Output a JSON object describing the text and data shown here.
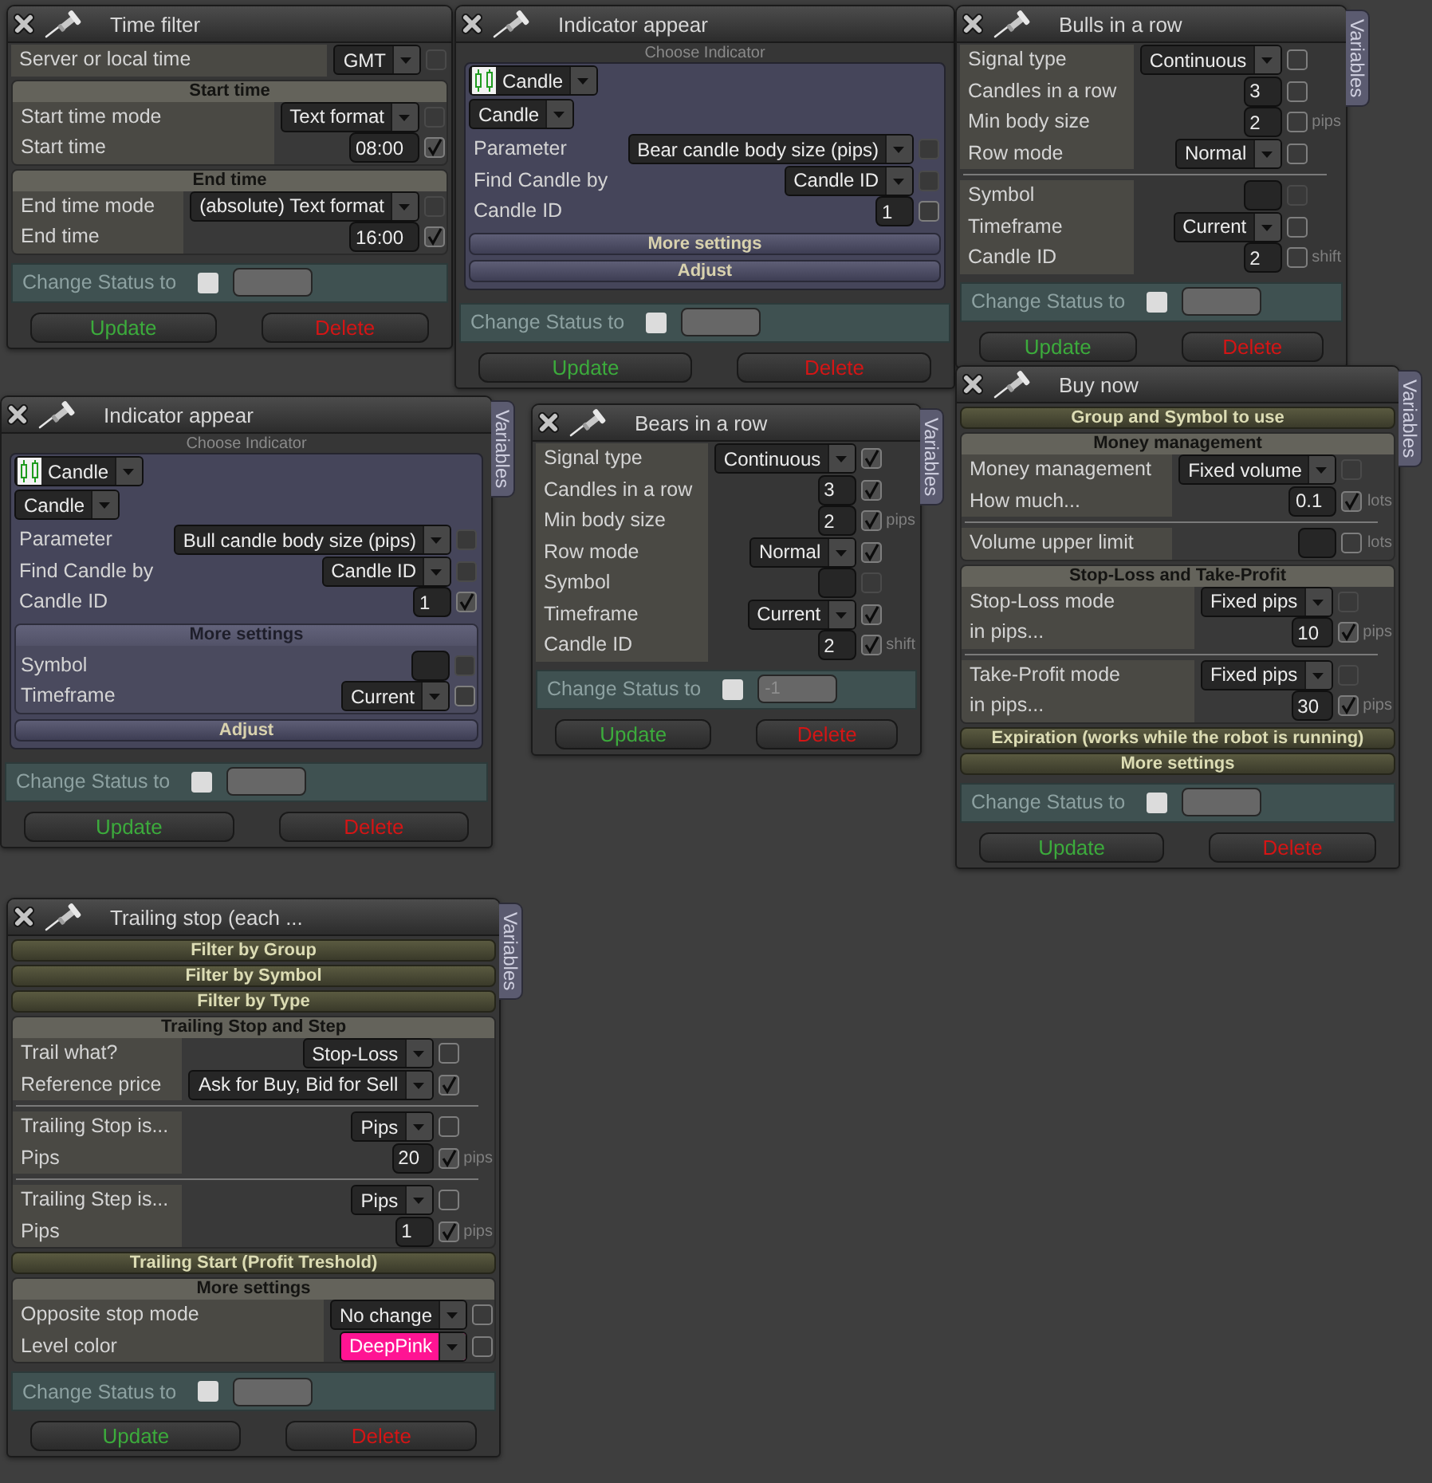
{
  "windows": [
    {
      "title": "Time filter",
      "blocks": [
        {
          "kind": "rows",
          "rows": [
            {
              "kind": "setting",
              "label": "Server or local time",
              "control": {
                "kind": "select",
                "value": "GMT"
              },
              "check": {
                "checked": false,
                "disabled": true
              }
            }
          ]
        },
        {
          "kind": "section",
          "title": "Start time",
          "expanded": true,
          "rows": [
            {
              "kind": "setting",
              "label": "Start time mode",
              "control": {
                "kind": "select",
                "value": "Text format"
              },
              "check": {
                "checked": false,
                "disabled": true
              }
            },
            {
              "kind": "setting",
              "label": "Start time",
              "control": {
                "kind": "input",
                "value": "08:00"
              },
              "check": {
                "checked": true,
                "disabled": false
              }
            }
          ]
        },
        {
          "kind": "section",
          "title": "End time",
          "expanded": true,
          "rows": [
            {
              "kind": "setting",
              "label": "End time mode",
              "control": {
                "kind": "select",
                "value": "(absolute) Text format"
              },
              "check": {
                "checked": false,
                "disabled": true
              }
            },
            {
              "kind": "setting",
              "label": "End time",
              "control": {
                "kind": "input",
                "value": "16:00"
              },
              "check": {
                "checked": true,
                "disabled": false
              }
            }
          ]
        }
      ],
      "status": {
        "label": "Change Status to",
        "checked": false
      },
      "buttons": [
        {
          "kind": "update",
          "label": "Update"
        },
        {
          "kind": "delete",
          "label": "Delete"
        }
      ]
    },
    {
      "title": "Indicator appear",
      "blocks": [
        {
          "kind": "indicator",
          "caption": "Choose Indicator",
          "pickers": [
            {
              "kind": "indicator",
              "value": "Candle"
            },
            {
              "kind": "plain",
              "value": "Candle"
            }
          ],
          "rows": [
            {
              "kind": "setting",
              "label": "Parameter",
              "control": {
                "kind": "select",
                "value": "Bear candle body size (pips)"
              },
              "check": {
                "checked": false,
                "disabled": true
              }
            },
            {
              "kind": "setting",
              "label": "Find Candle by",
              "control": {
                "kind": "select",
                "value": "Candle ID"
              },
              "check": {
                "checked": false,
                "disabled": true
              }
            },
            {
              "kind": "setting",
              "label": "Candle ID",
              "control": {
                "kind": "input",
                "value": "1"
              },
              "check": {
                "checked": false,
                "disabled": false
              }
            }
          ],
          "sections": [
            {
              "title": "More settings",
              "expanded": false
            },
            {
              "title": "Adjust",
              "expanded": false
            }
          ]
        }
      ],
      "status": {
        "label": "Change Status to",
        "checked": false
      },
      "buttons": [
        {
          "kind": "update",
          "label": "Update"
        },
        {
          "kind": "delete",
          "label": "Delete"
        }
      ]
    },
    {
      "title": "Bulls in a row",
      "side_tab": "Variables",
      "blocks": [
        {
          "kind": "rows",
          "rows": [
            {
              "kind": "setting",
              "label": "Signal type",
              "control": {
                "kind": "select",
                "value": "Continuous"
              },
              "check": {
                "checked": false,
                "disabled": false
              }
            },
            {
              "kind": "setting",
              "label": "Candles in a row",
              "control": {
                "kind": "input",
                "value": "3"
              },
              "check": {
                "checked": false,
                "disabled": false
              }
            },
            {
              "kind": "setting",
              "label": "Min body size",
              "control": {
                "kind": "input",
                "value": "2"
              },
              "check": {
                "checked": false,
                "disabled": false
              },
              "unit": "pips"
            },
            {
              "kind": "setting",
              "label": "Row mode",
              "control": {
                "kind": "select",
                "value": "Normal"
              },
              "check": {
                "checked": false,
                "disabled": false
              }
            },
            {
              "kind": "divider"
            },
            {
              "kind": "setting",
              "label": "Symbol",
              "control": {
                "kind": "input"
              },
              "check": {
                "checked": false,
                "disabled": true
              }
            },
            {
              "kind": "setting",
              "label": "Timeframe",
              "control": {
                "kind": "select",
                "value": "Current"
              },
              "check": {
                "checked": false,
                "disabled": false
              }
            },
            {
              "kind": "setting",
              "label": "Candle ID",
              "control": {
                "kind": "input",
                "value": "2"
              },
              "check": {
                "checked": false,
                "disabled": false
              },
              "unit": "shift"
            }
          ]
        }
      ],
      "status": {
        "label": "Change Status to",
        "checked": false
      },
      "buttons": [
        {
          "kind": "update",
          "label": "Update"
        },
        {
          "kind": "delete",
          "label": "Delete"
        }
      ]
    },
    {
      "title": "Indicator appear",
      "side_tab": "Variables",
      "blocks": [
        {
          "kind": "indicator",
          "caption": "Choose Indicator",
          "pickers": [
            {
              "kind": "indicator",
              "value": "Candle"
            },
            {
              "kind": "plain",
              "value": "Candle"
            }
          ],
          "rows": [
            {
              "kind": "setting",
              "label": "Parameter",
              "control": {
                "kind": "select",
                "value": "Bull candle body size (pips)"
              },
              "check": {
                "checked": false,
                "disabled": true
              }
            },
            {
              "kind": "setting",
              "label": "Find Candle by",
              "control": {
                "kind": "select",
                "value": "Candle ID"
              },
              "check": {
                "checked": false,
                "disabled": true
              }
            },
            {
              "kind": "setting",
              "label": "Candle ID",
              "control": {
                "kind": "input",
                "value": "1"
              },
              "check": {
                "checked": true,
                "disabled": false
              }
            }
          ],
          "sections": [
            {
              "title": "More settings",
              "expanded": true,
              "rows": [
                {
                  "kind": "setting",
                  "label": "Symbol",
                  "control": {
                    "kind": "input"
                  },
                  "check": {
                    "checked": false,
                    "disabled": true
                  }
                },
                {
                  "kind": "setting",
                  "label": "Timeframe",
                  "control": {
                    "kind": "select",
                    "value": "Current"
                  },
                  "check": {
                    "checked": false,
                    "disabled": false
                  }
                }
              ]
            },
            {
              "title": "Adjust",
              "expanded": false
            }
          ]
        }
      ],
      "status": {
        "label": "Change Status to",
        "checked": false
      },
      "buttons": [
        {
          "kind": "update",
          "label": "Update"
        },
        {
          "kind": "delete",
          "label": "Delete"
        }
      ]
    },
    {
      "title": "Bears in a row",
      "side_tab": "Variables",
      "blocks": [
        {
          "kind": "rows",
          "rows": [
            {
              "kind": "setting",
              "label": "Signal type",
              "control": {
                "kind": "select",
                "value": "Continuous"
              },
              "check": {
                "checked": true,
                "disabled": false
              }
            },
            {
              "kind": "setting",
              "label": "Candles in a row",
              "control": {
                "kind": "input",
                "value": "3"
              },
              "check": {
                "checked": true,
                "disabled": false
              }
            },
            {
              "kind": "setting",
              "label": "Min body size",
              "control": {
                "kind": "input",
                "value": "2"
              },
              "check": {
                "checked": true,
                "disabled": false
              },
              "unit": "pips"
            },
            {
              "kind": "setting",
              "label": "Row mode",
              "control": {
                "kind": "select",
                "value": "Normal"
              },
              "check": {
                "checked": true,
                "disabled": false
              }
            },
            {
              "kind": "setting",
              "label": "Symbol",
              "control": {
                "kind": "input"
              },
              "check": {
                "checked": false,
                "disabled": true
              }
            },
            {
              "kind": "setting",
              "label": "Timeframe",
              "control": {
                "kind": "select",
                "value": "Current"
              },
              "check": {
                "checked": true,
                "disabled": false
              }
            },
            {
              "kind": "setting",
              "label": "Candle ID",
              "control": {
                "kind": "input",
                "value": "2"
              },
              "check": {
                "checked": true,
                "disabled": false
              },
              "unit": "shift"
            }
          ]
        }
      ],
      "status": {
        "label": "Change Status to",
        "checked": false,
        "placeholder": "-1"
      },
      "buttons": [
        {
          "kind": "update",
          "label": "Update"
        },
        {
          "kind": "delete",
          "label": "Delete"
        }
      ]
    },
    {
      "title": "Buy now",
      "side_tab": "Variables",
      "blocks": [
        {
          "kind": "section",
          "title": "Group and Symbol to use",
          "expanded": false
        },
        {
          "kind": "section",
          "title": "Money management",
          "expanded": true,
          "rows": [
            {
              "kind": "setting",
              "label": "Money management",
              "control": {
                "kind": "select",
                "value": "Fixed volume"
              },
              "check": {
                "checked": false,
                "disabled": true
              }
            },
            {
              "kind": "setting",
              "label": "How much...",
              "control": {
                "kind": "input",
                "value": "0.1"
              },
              "check": {
                "checked": true,
                "disabled": false
              },
              "unit": "lots"
            },
            {
              "kind": "divider"
            },
            {
              "kind": "setting",
              "label": "Volume upper limit",
              "control": {
                "kind": "input"
              },
              "check": {
                "checked": false,
                "disabled": false
              },
              "unit": "lots"
            }
          ]
        },
        {
          "kind": "section",
          "title": "Stop-Loss and Take-Profit",
          "expanded": true,
          "rows": [
            {
              "kind": "setting",
              "label": "Stop-Loss mode",
              "control": {
                "kind": "select",
                "value": "Fixed pips"
              },
              "check": {
                "checked": false,
                "disabled": true
              }
            },
            {
              "kind": "setting",
              "label": "in pips...",
              "control": {
                "kind": "input",
                "value": "10"
              },
              "check": {
                "checked": true,
                "disabled": false
              },
              "unit": "pips"
            },
            {
              "kind": "divider"
            },
            {
              "kind": "setting",
              "label": "Take-Profit mode",
              "control": {
                "kind": "select",
                "value": "Fixed pips"
              },
              "check": {
                "checked": false,
                "disabled": true
              }
            },
            {
              "kind": "setting",
              "label": "in pips...",
              "control": {
                "kind": "input",
                "value": "30"
              },
              "check": {
                "checked": true,
                "disabled": false
              },
              "unit": "pips"
            }
          ]
        },
        {
          "kind": "section",
          "title": "Expiration (works while the robot is running)",
          "expanded": false
        },
        {
          "kind": "section",
          "title": "More settings",
          "expanded": false
        }
      ],
      "status": {
        "label": "Change Status to",
        "checked": false
      },
      "buttons": [
        {
          "kind": "update",
          "label": "Update"
        },
        {
          "kind": "delete",
          "label": "Delete"
        }
      ]
    },
    {
      "title": "Trailing stop (each ...",
      "side_tab": "Variables",
      "blocks": [
        {
          "kind": "section",
          "title": "Filter by Group",
          "expanded": false
        },
        {
          "kind": "section",
          "title": "Filter by Symbol",
          "expanded": false
        },
        {
          "kind": "section",
          "title": "Filter by Type",
          "expanded": false
        },
        {
          "kind": "section",
          "title": "Trailing Stop and Step",
          "expanded": true,
          "rows": [
            {
              "kind": "setting",
              "label": "Trail what?",
              "control": {
                "kind": "select",
                "value": "Stop-Loss"
              },
              "check": {
                "checked": false,
                "disabled": false
              }
            },
            {
              "kind": "setting",
              "label": "Reference price",
              "control": {
                "kind": "select",
                "value": "Ask for Buy, Bid for Sell"
              },
              "check": {
                "checked": true,
                "disabled": false
              }
            },
            {
              "kind": "divider"
            },
            {
              "kind": "setting",
              "label": "Trailing Stop is...",
              "control": {
                "kind": "select",
                "value": "Pips"
              },
              "check": {
                "checked": false,
                "disabled": false
              }
            },
            {
              "kind": "setting",
              "label": "Pips",
              "control": {
                "kind": "input",
                "value": "20"
              },
              "check": {
                "checked": true,
                "disabled": false
              },
              "unit": "pips"
            },
            {
              "kind": "divider"
            },
            {
              "kind": "setting",
              "label": "Trailing Step is...",
              "control": {
                "kind": "select",
                "value": "Pips"
              },
              "check": {
                "checked": false,
                "disabled": false
              }
            },
            {
              "kind": "setting",
              "label": "Pips",
              "control": {
                "kind": "input",
                "value": "1"
              },
              "check": {
                "checked": true,
                "disabled": false
              },
              "unit": "pips"
            }
          ]
        },
        {
          "kind": "section",
          "title": "Trailing Start (Profit Treshold)",
          "expanded": false
        },
        {
          "kind": "section",
          "title": "More settings",
          "expanded": true,
          "rows": [
            {
              "kind": "setting",
              "label": "Opposite stop mode",
              "control": {
                "kind": "select",
                "value": "No change"
              },
              "check": {
                "checked": false,
                "disabled": false
              }
            },
            {
              "kind": "setting",
              "label": "Level color",
              "control": {
                "kind": "select",
                "value": "DeepPink",
                "color": "#ff1493"
              },
              "check": {
                "checked": false,
                "disabled": false
              }
            }
          ]
        }
      ],
      "status": {
        "label": "Change Status to",
        "checked": false
      },
      "buttons": [
        {
          "kind": "update",
          "label": "Update"
        },
        {
          "kind": "delete",
          "label": "Delete"
        }
      ]
    }
  ]
}
